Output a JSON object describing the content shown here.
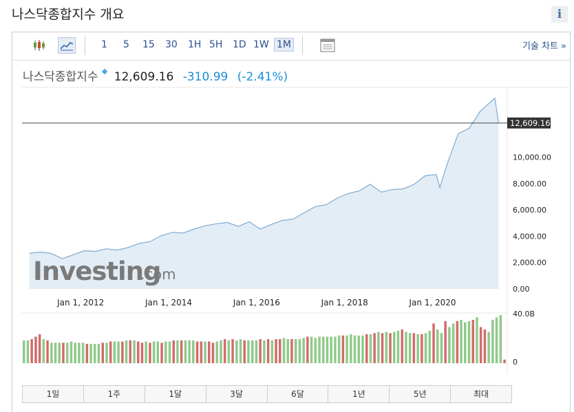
{
  "page": {
    "title": "나스닥종합지수 개요",
    "info_label": "i"
  },
  "toolbar": {
    "intervals": [
      "1",
      "5",
      "15",
      "30",
      "1H",
      "5H",
      "1D",
      "1W",
      "1M"
    ],
    "active_interval": "1M",
    "technical_chart_label": "기술 차트 »"
  },
  "quote": {
    "name": "나스닥종합지수",
    "price": "12,609.16",
    "change": "-310.99",
    "change_pct": "(-2.41%)"
  },
  "colors": {
    "line": "#7fa9d1",
    "area": "#e3edf5",
    "vol_up": "#90c98a",
    "vol_down": "#d26b6b",
    "price_tag": "#333333",
    "accent": "#1a8fd8"
  },
  "chart_data": {
    "type": "area",
    "x": [
      "2010-11",
      "2011-02",
      "2011-05",
      "2011-08",
      "2011-11",
      "2012-02",
      "2012-05",
      "2012-08",
      "2012-11",
      "2013-02",
      "2013-05",
      "2013-08",
      "2013-11",
      "2014-02",
      "2014-05",
      "2014-08",
      "2014-11",
      "2015-02",
      "2015-05",
      "2015-08",
      "2015-11",
      "2016-02",
      "2016-05",
      "2016-08",
      "2016-11",
      "2017-02",
      "2017-05",
      "2017-08",
      "2017-11",
      "2018-02",
      "2018-05",
      "2018-08",
      "2018-11",
      "2019-02",
      "2019-05",
      "2019-08",
      "2019-11",
      "2020-02",
      "2020-03",
      "2020-05",
      "2020-08",
      "2020-11",
      "2021-02",
      "2021-04",
      "2021-06",
      "2021-07"
    ],
    "y": [
      2700,
      2800,
      2700,
      2300,
      2600,
      2900,
      2850,
      3050,
      2950,
      3150,
      3450,
      3600,
      4050,
      4300,
      4250,
      4550,
      4800,
      4950,
      5050,
      4750,
      5100,
      4550,
      4900,
      5200,
      5300,
      5800,
      6250,
      6400,
      6900,
      7250,
      7450,
      7950,
      7350,
      7550,
      7600,
      7950,
      8600,
      8700,
      7700,
      9500,
      11800,
      12200,
      13500,
      14000,
      14500,
      12609.16
    ],
    "price_label": "12,609.16",
    "yticks": [
      "0.00",
      "2,000.00",
      "4,000.00",
      "6,000.00",
      "8,000.00",
      "10,000.00"
    ],
    "ytick_values": [
      0,
      2000,
      4000,
      6000,
      8000,
      10000
    ],
    "ylim": [
      0,
      14900
    ],
    "xticks": [
      "Jan 1, 2012",
      "Jan 1, 2014",
      "Jan 1, 2016",
      "Jan 1, 2018",
      "Jan 1, 2020"
    ],
    "xtick_dates": [
      "2012-01",
      "2014-01",
      "2016-01",
      "2018-01",
      "2020-01"
    ],
    "xlim": [
      "2010-09",
      "2021-09"
    ],
    "volume": {
      "unit_top": "40.0B",
      "unit_bottom": "0",
      "values_b": [
        19,
        19,
        20,
        22,
        24,
        20,
        19,
        17,
        17,
        17,
        17,
        17,
        18,
        17,
        17,
        17,
        16,
        16,
        16,
        16,
        17,
        17,
        18,
        18,
        18,
        18,
        19,
        19,
        19,
        18,
        17,
        18,
        17,
        18,
        18,
        17,
        18,
        18,
        19,
        19,
        19,
        19,
        19,
        19,
        18,
        18,
        18,
        18,
        17,
        18,
        19,
        20,
        19,
        20,
        19,
        20,
        19,
        19,
        19,
        19,
        20,
        19,
        20,
        19,
        20,
        20,
        21,
        20,
        20,
        20,
        20,
        21,
        22,
        22,
        21,
        22,
        22,
        22,
        22,
        22,
        23,
        23,
        23,
        24,
        23,
        23,
        23,
        24,
        24,
        25,
        26,
        25,
        26,
        25,
        26,
        27,
        28,
        26,
        25,
        25,
        24,
        24,
        25,
        27,
        33,
        28,
        25,
        35,
        30,
        33,
        35,
        36,
        34,
        35,
        36,
        38,
        30,
        28,
        26,
        36,
        38,
        40,
        3
      ],
      "down_flags": [
        0,
        0,
        1,
        1,
        1,
        0,
        1,
        0,
        0,
        0,
        1,
        0,
        0,
        0,
        0,
        0,
        1,
        0,
        0,
        0,
        1,
        0,
        1,
        0,
        0,
        1,
        0,
        1,
        0,
        1,
        1,
        0,
        1,
        0,
        0,
        1,
        0,
        0,
        1,
        0,
        1,
        0,
        0,
        0,
        1,
        1,
        0,
        1,
        1,
        0,
        0,
        1,
        0,
        1,
        0,
        0,
        1,
        0,
        0,
        0,
        1,
        0,
        1,
        0,
        1,
        1,
        0,
        0,
        1,
        0,
        0,
        0,
        1,
        0,
        0,
        0,
        0,
        0,
        0,
        0,
        0,
        1,
        0,
        0,
        0,
        0,
        0,
        1,
        0,
        1,
        0,
        1,
        0,
        1,
        0,
        0,
        1,
        0,
        0,
        1,
        0,
        1,
        0,
        0,
        1,
        0,
        0,
        1,
        0,
        0,
        1,
        0,
        0,
        0,
        1,
        0,
        1,
        1,
        0,
        0,
        0,
        0,
        1
      ]
    }
  },
  "watermark": {
    "brand": "Investing",
    "suffix": ".com"
  },
  "ranges": [
    "1일",
    "1주",
    "1달",
    "3달",
    "6달",
    "1년",
    "5년",
    "최대"
  ]
}
